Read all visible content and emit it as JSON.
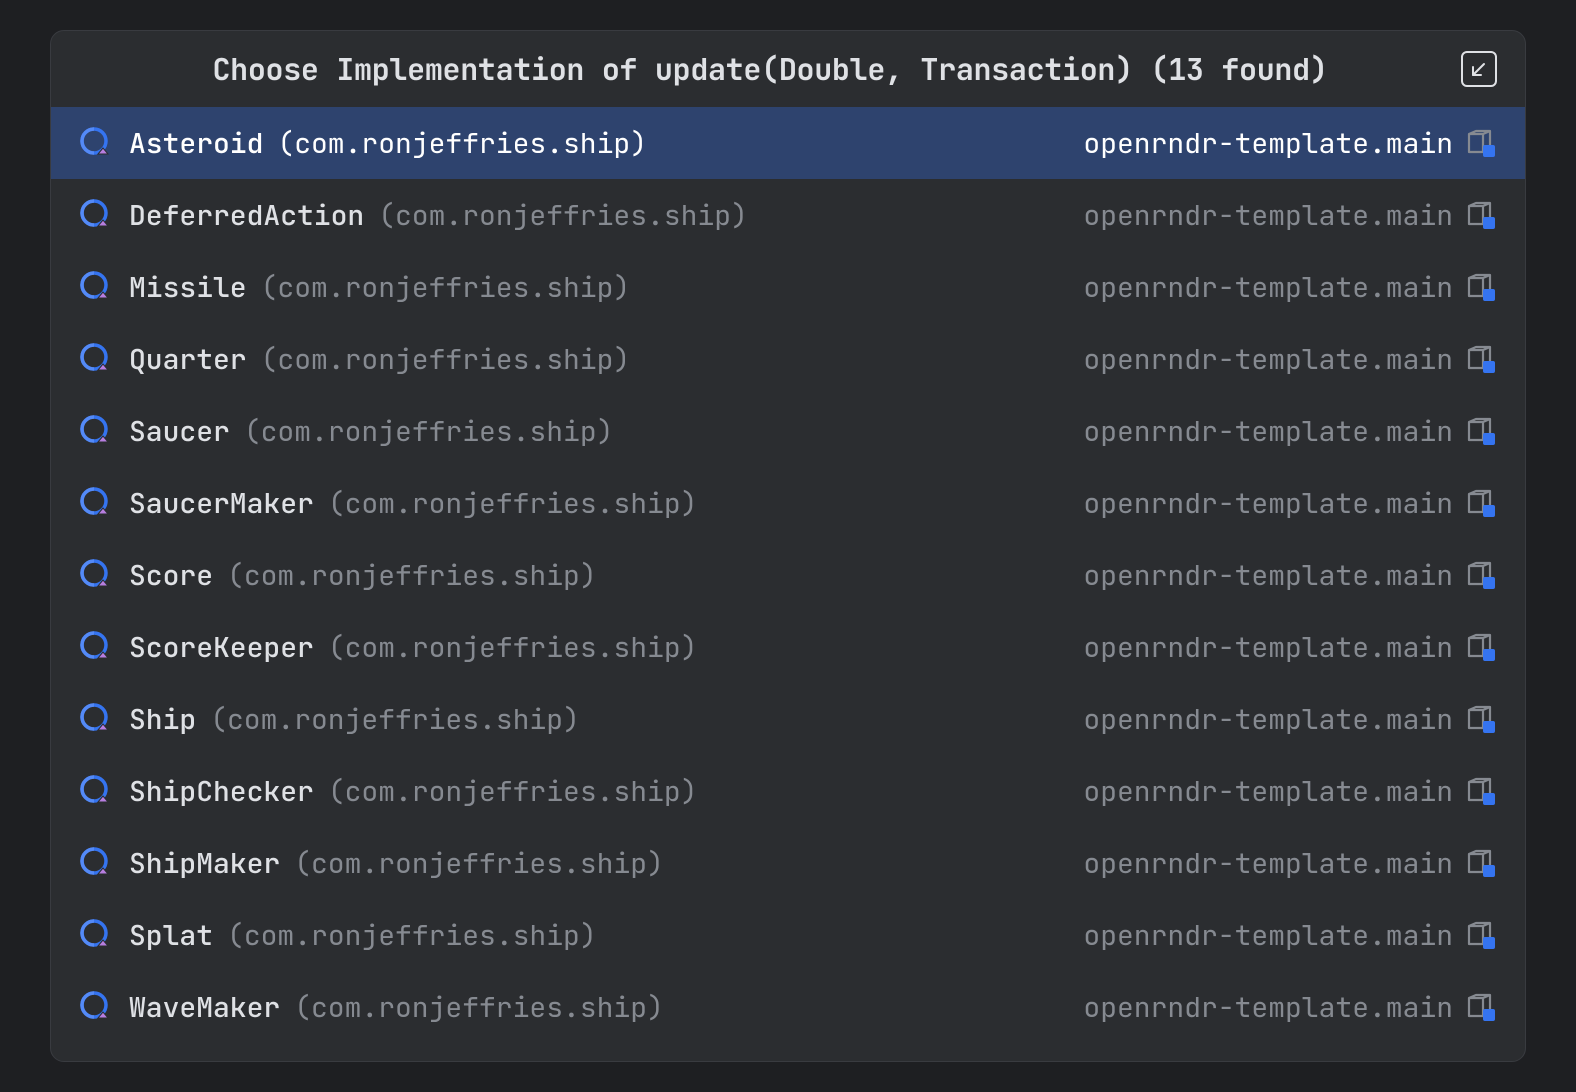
{
  "header": {
    "title": "Choose Implementation of update(Double, Transaction) (13 found)"
  },
  "list": {
    "items": [
      {
        "name": "Asteroid",
        "package": "(com.ronjeffries.ship)",
        "module": "openrndr-template.main",
        "selected": true
      },
      {
        "name": "DeferredAction",
        "package": "(com.ronjeffries.ship)",
        "module": "openrndr-template.main",
        "selected": false
      },
      {
        "name": "Missile",
        "package": "(com.ronjeffries.ship)",
        "module": "openrndr-template.main",
        "selected": false
      },
      {
        "name": "Quarter",
        "package": "(com.ronjeffries.ship)",
        "module": "openrndr-template.main",
        "selected": false
      },
      {
        "name": "Saucer",
        "package": "(com.ronjeffries.ship)",
        "module": "openrndr-template.main",
        "selected": false
      },
      {
        "name": "SaucerMaker",
        "package": "(com.ronjeffries.ship)",
        "module": "openrndr-template.main",
        "selected": false
      },
      {
        "name": "Score",
        "package": "(com.ronjeffries.ship)",
        "module": "openrndr-template.main",
        "selected": false
      },
      {
        "name": "ScoreKeeper",
        "package": "(com.ronjeffries.ship)",
        "module": "openrndr-template.main",
        "selected": false
      },
      {
        "name": "Ship",
        "package": "(com.ronjeffries.ship)",
        "module": "openrndr-template.main",
        "selected": false
      },
      {
        "name": "ShipChecker",
        "package": "(com.ronjeffries.ship)",
        "module": "openrndr-template.main",
        "selected": false
      },
      {
        "name": "ShipMaker",
        "package": "(com.ronjeffries.ship)",
        "module": "openrndr-template.main",
        "selected": false
      },
      {
        "name": "Splat",
        "package": "(com.ronjeffries.ship)",
        "module": "openrndr-template.main",
        "selected": false
      },
      {
        "name": "WaveMaker",
        "package": "(com.ronjeffries.ship)",
        "module": "openrndr-template.main",
        "selected": false
      }
    ]
  }
}
